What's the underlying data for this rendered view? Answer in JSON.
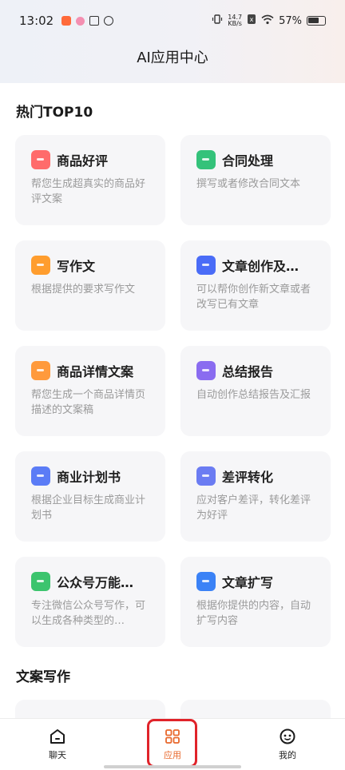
{
  "status_bar": {
    "time": "13:02",
    "speed_value": "14.7",
    "speed_unit": "KB/s",
    "battery": "57%"
  },
  "header": {
    "title": "AI应用中心"
  },
  "sections": [
    {
      "title": "热门TOP10"
    },
    {
      "title": "文案写作"
    }
  ],
  "cards": [
    {
      "title": "商品好评",
      "desc": "帮您生成超真实的商品好评文案",
      "icon": "gift-icon",
      "color": "#ff6b6b"
    },
    {
      "title": "合同处理",
      "desc": "撰写或者修改合同文本",
      "icon": "contract-icon",
      "color": "#34c27a"
    },
    {
      "title": "写作文",
      "desc": "根据提供的要求写作文",
      "icon": "essay-icon",
      "color": "#ff9d2e"
    },
    {
      "title": "文章创作及…",
      "desc": "可以帮你创作新文章或者改写已有文章",
      "icon": "pen-icon",
      "color": "#4a6cf7"
    },
    {
      "title": "商品详情文案",
      "desc": "帮您生成一个商品详情页描述的文案稿",
      "icon": "document-icon",
      "color": "#ff9a3c"
    },
    {
      "title": "总结报告",
      "desc": "自动创作总结报告及汇报",
      "icon": "report-icon",
      "color": "#8a6cf0"
    },
    {
      "title": "商业计划书",
      "desc": "根据企业目标生成商业计划书",
      "icon": "plan-icon",
      "color": "#5b7cf6"
    },
    {
      "title": "差评转化",
      "desc": "应对客户差评，转化差评为好评",
      "icon": "refresh-icon",
      "color": "#6b7cf2"
    },
    {
      "title": "公众号万能…",
      "desc": "专注微信公众号写作，可以生成各种类型的…",
      "icon": "check-icon",
      "color": "#3cc46e"
    },
    {
      "title": "文章扩写",
      "desc": "根据你提供的内容，自动扩写内容",
      "icon": "expand-icon",
      "color": "#3b82f6"
    }
  ],
  "tabs": [
    {
      "label": "聊天",
      "icon": "home-icon"
    },
    {
      "label": "应用",
      "icon": "apps-icon",
      "active": true
    },
    {
      "label": "我的",
      "icon": "profile-icon"
    }
  ]
}
